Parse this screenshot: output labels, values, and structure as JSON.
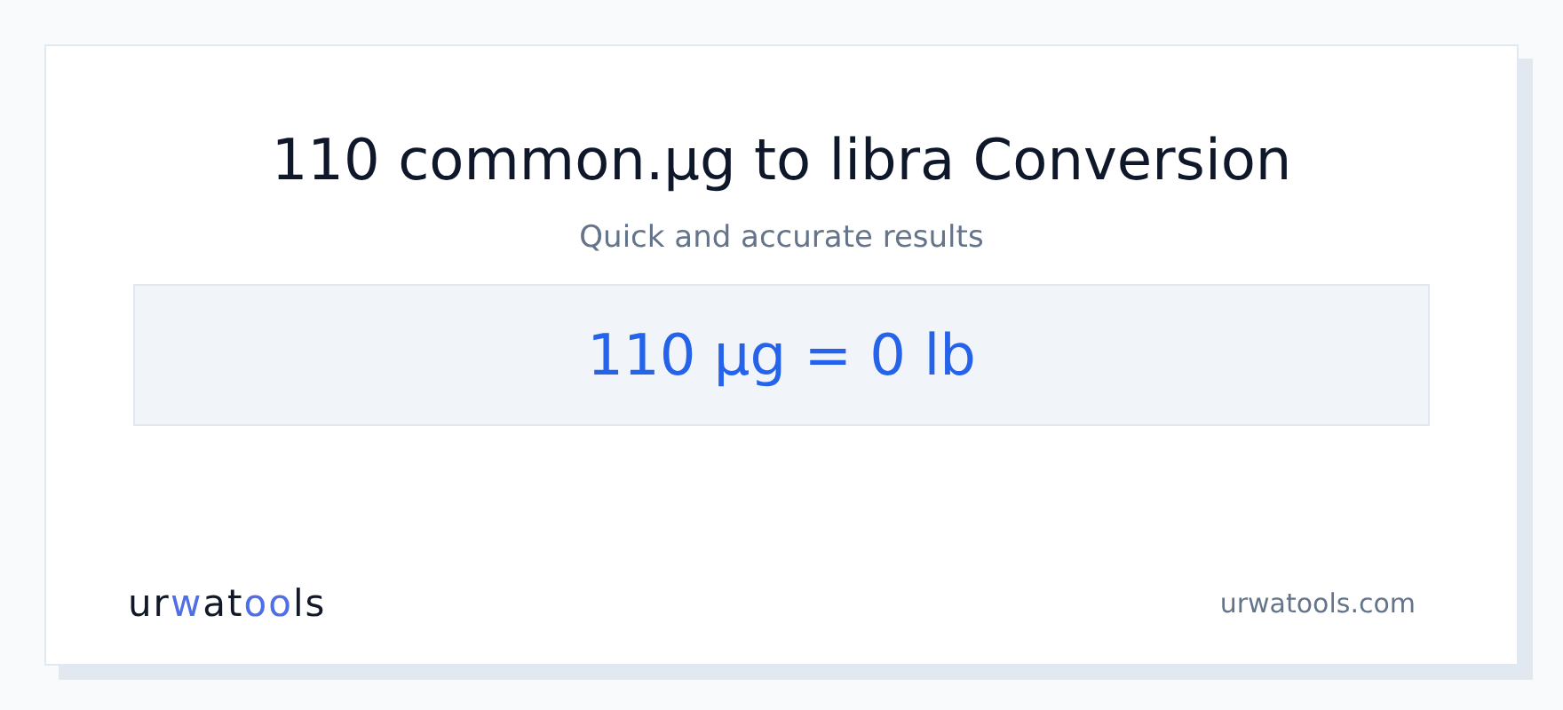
{
  "title": "110 common.µg to libra Conversion",
  "subtitle": "Quick and accurate results",
  "result": "110 µg = 0 lb",
  "logo": [
    {
      "text": "ur",
      "accent": false
    },
    {
      "text": "w",
      "accent": true
    },
    {
      "text": "at",
      "accent": false
    },
    {
      "text": "oo",
      "accent": true
    },
    {
      "text": "ls",
      "accent": false
    }
  ],
  "site": "urwatools.com"
}
